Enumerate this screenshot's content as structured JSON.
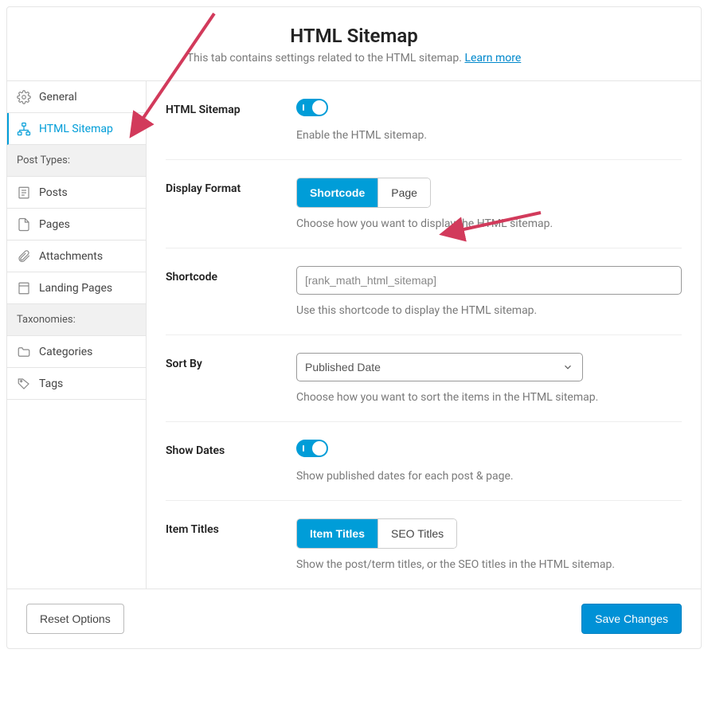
{
  "header": {
    "title": "HTML Sitemap",
    "subtitle_prefix": "This tab contains settings related to the HTML sitemap. ",
    "learn_more": "Learn more"
  },
  "sidebar": {
    "general": "General",
    "html_sitemap": "HTML Sitemap",
    "group_post_types": "Post Types:",
    "posts": "Posts",
    "pages": "Pages",
    "attachments": "Attachments",
    "landing_pages": "Landing Pages",
    "group_taxonomies": "Taxonomies:",
    "categories": "Categories",
    "tags": "Tags"
  },
  "settings": {
    "html_sitemap": {
      "label": "HTML Sitemap",
      "desc": "Enable the HTML sitemap.",
      "value": true
    },
    "display_format": {
      "label": "Display Format",
      "options": {
        "shortcode": "Shortcode",
        "page": "Page"
      },
      "selected": "shortcode",
      "desc": "Choose how you want to display the HTML sitemap."
    },
    "shortcode": {
      "label": "Shortcode",
      "placeholder": "[rank_math_html_sitemap]",
      "value": "",
      "desc": "Use this shortcode to display the HTML sitemap."
    },
    "sort_by": {
      "label": "Sort By",
      "selected": "Published Date",
      "options": [
        "Published Date"
      ],
      "desc": "Choose how you want to sort the items in the HTML sitemap."
    },
    "show_dates": {
      "label": "Show Dates",
      "value": true,
      "desc": "Show published dates for each post & page."
    },
    "item_titles": {
      "label": "Item Titles",
      "options": {
        "item": "Item Titles",
        "seo": "SEO Titles"
      },
      "selected": "item",
      "desc": "Show the post/term titles, or the SEO titles in the HTML sitemap."
    }
  },
  "footer": {
    "reset": "Reset Options",
    "save": "Save Changes"
  },
  "colors": {
    "accent": "#009dd8",
    "arrow": "#d23a5b"
  }
}
